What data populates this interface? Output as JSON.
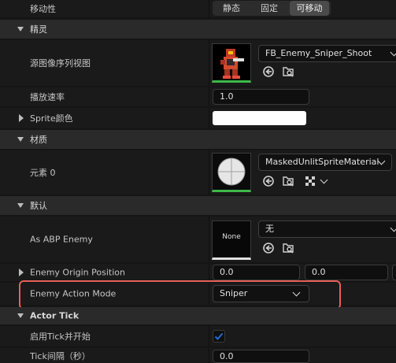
{
  "mobility": {
    "label": "移动性",
    "options": [
      "静态",
      "固定",
      "可移动"
    ],
    "selected_index": 2
  },
  "sprite_section": {
    "title": "精灵"
  },
  "source_flipbook": {
    "label": "源图像序列视图",
    "asset_name": "FB_Enemy_Sniper_Shoot"
  },
  "play_rate": {
    "label": "播放速率",
    "value": "1.0"
  },
  "sprite_color": {
    "label": "Sprite颜色",
    "color": "#ffffff"
  },
  "materials_section": {
    "title": "材质"
  },
  "element0": {
    "label": "元素 0",
    "asset_name": "MaskedUnlitSpriteMaterial"
  },
  "default_section": {
    "title": "默认"
  },
  "as_abp_enemy": {
    "label": "As ABP Enemy",
    "thumb_text": "None",
    "value": "无"
  },
  "enemy_origin_position": {
    "label": "Enemy Origin Position",
    "x": "0.0",
    "y": "0.0"
  },
  "enemy_action_mode": {
    "label": "Enemy Action Mode",
    "value": "Sniper"
  },
  "actor_tick_section": {
    "title": "Actor Tick"
  },
  "start_with_tick": {
    "label": "启用Tick并开始",
    "checked": true
  },
  "tick_interval": {
    "label": "Tick间隔（秒）",
    "value": "0.0"
  },
  "colors": {
    "highlight_outline": "#e5605b",
    "accent_blue": "#1f6fd1",
    "selected_segment": "#4a4a4a"
  }
}
